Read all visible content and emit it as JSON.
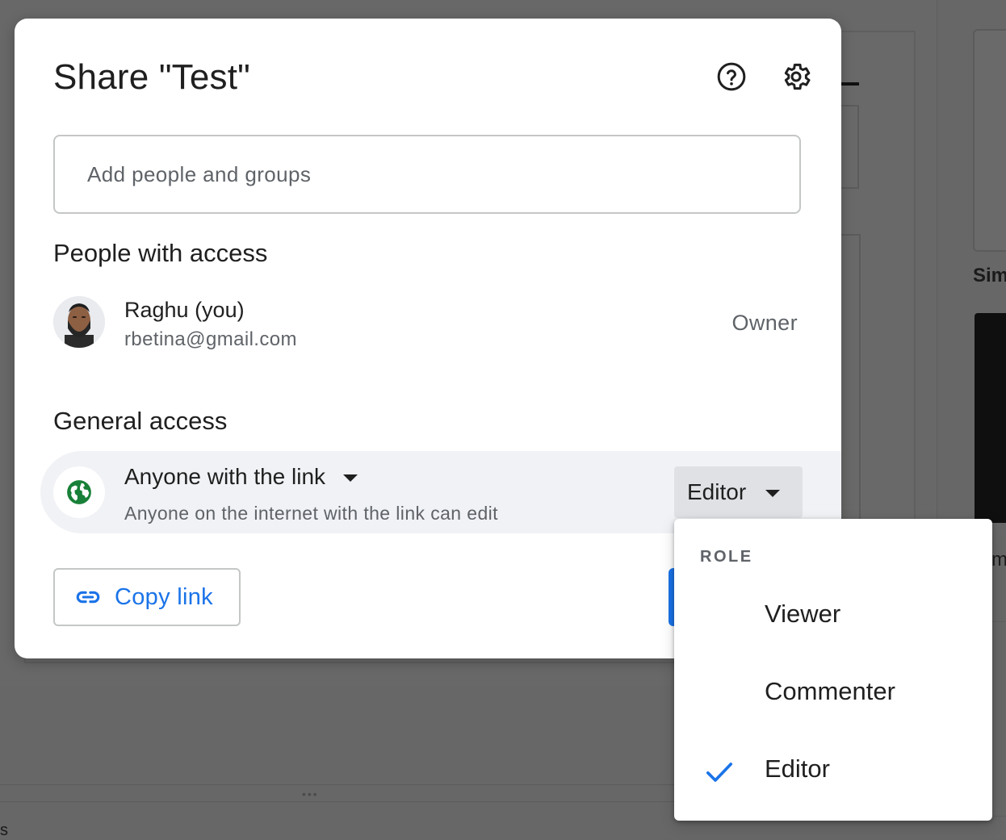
{
  "dialog": {
    "title": "Share \"Test\"",
    "help_icon": "help-circle-icon",
    "settings_icon": "gear-icon"
  },
  "add_people": {
    "placeholder": "Add people and groups"
  },
  "people_section": {
    "heading": "People with access",
    "people": [
      {
        "name": "Raghu (you)",
        "email": "rbetina@gmail.com",
        "role": "Owner"
      }
    ]
  },
  "general_access": {
    "heading": "General access",
    "scope": "Anyone with the link",
    "description": "Anyone on the internet with the link can edit",
    "role": "Editor",
    "globe_color": "#188038"
  },
  "footer": {
    "copy_link_label": "Copy link",
    "accent_color": "#1a73e8"
  },
  "role_menu": {
    "header": "ROLE",
    "items": [
      {
        "label": "Viewer",
        "selected": false
      },
      {
        "label": "Commenter",
        "selected": false
      },
      {
        "label": "Editor",
        "selected": true
      }
    ]
  },
  "background": {
    "right_label": "Sim",
    "right_label_2": "m",
    "bottom_label": "s"
  }
}
